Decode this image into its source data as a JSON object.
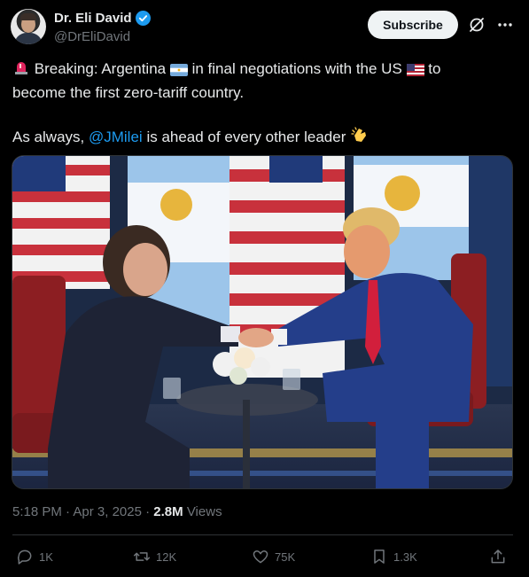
{
  "author": {
    "name": "Dr. Eli David",
    "handle": "@DrEliDavid",
    "verified_color": "#1d9bf0"
  },
  "header": {
    "subscribe_label": "Subscribe",
    "grok_icon": "grok-icon",
    "more_icon": "more-icon"
  },
  "tweet": {
    "line1_emoji": "rotating-light-emoji",
    "line1_prefix": "Breaking: Argentina",
    "flag1": "argentina-flag-emoji",
    "line1_mid": "in final negotiations with the US",
    "flag2": "us-flag-emoji",
    "line1_suffix": "to",
    "line2": "become the first zero-tariff country.",
    "line3_prefix": "As always,",
    "mention": "@JMilei",
    "line3_suffix": "is ahead of every other leader",
    "line3_emoji": "clapping-hands-emoji"
  },
  "meta": {
    "time": "5:18 PM",
    "date": "Apr 3, 2025",
    "views_count": "2.8M",
    "views_label": "Views"
  },
  "actions": {
    "replies": "1K",
    "reposts": "12K",
    "likes": "75K",
    "bookmarks": "1.3K"
  },
  "colors": {
    "background": "#000000",
    "text": "#e7e9ea",
    "muted": "#71767b",
    "accent": "#1d9bf0",
    "divider": "#2f3336"
  }
}
